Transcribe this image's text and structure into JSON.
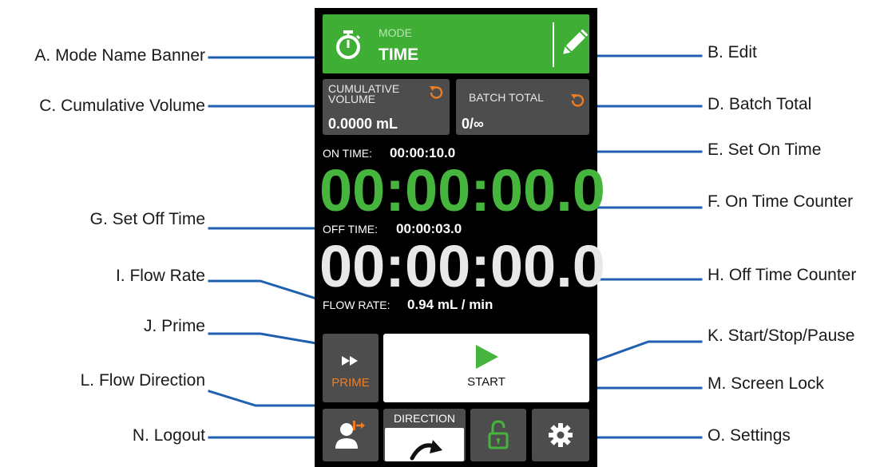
{
  "callouts": {
    "a": "A. Mode Name Banner",
    "b": "B. Edit",
    "c": "C. Cumulative Volume",
    "d": "D. Batch Total",
    "e": "E. Set On Time",
    "f": "F. On Time Counter",
    "g": "G. Set Off Time",
    "h": "H. Off Time Counter",
    "i": "I. Flow Rate",
    "j": "J. Prime",
    "k": "K. Start/Stop/Pause",
    "l": "L. Flow Direction",
    "m": "M. Screen Lock",
    "n": "N. Logout",
    "o": "O. Settings"
  },
  "screen": {
    "banner": {
      "mode_caption": "MODE",
      "mode_name": "TIME"
    },
    "cumulative": {
      "label_line1": "CUMULATIVE",
      "label_line2": "VOLUME",
      "value": "0.0000 mL"
    },
    "batch": {
      "label": "BATCH TOTAL",
      "value": "0/∞"
    },
    "on_time": {
      "label": "ON TIME:",
      "set_value": "00:00:10.0",
      "counter": "00:00:00.0"
    },
    "off_time": {
      "label": "OFF TIME:",
      "set_value": "00:00:03.0",
      "counter": "00:00:00.0"
    },
    "flow_rate": {
      "label": "FLOW RATE:",
      "value": "0.94",
      "unit": "mL / min"
    },
    "prime_label": "PRIME",
    "start_label": "START",
    "direction_label": "DIRECTION"
  },
  "colors": {
    "accent_green": "#3fae35",
    "counter_green": "#46b53d",
    "prime_orange": "#ef7d22",
    "leader_blue": "#1f5fb0",
    "tile_gray": "#4d4d4d"
  },
  "icons": {
    "banner": "stopwatch-icon",
    "edit": "pencil-icon",
    "reset": "reset-icon",
    "prime": "fast-forward-icon",
    "start": "play-icon",
    "direction": "clockwise-arrow-icon",
    "logout": "user-logout-icon",
    "lock": "unlocked-padlock-icon",
    "settings": "gear-icon"
  }
}
